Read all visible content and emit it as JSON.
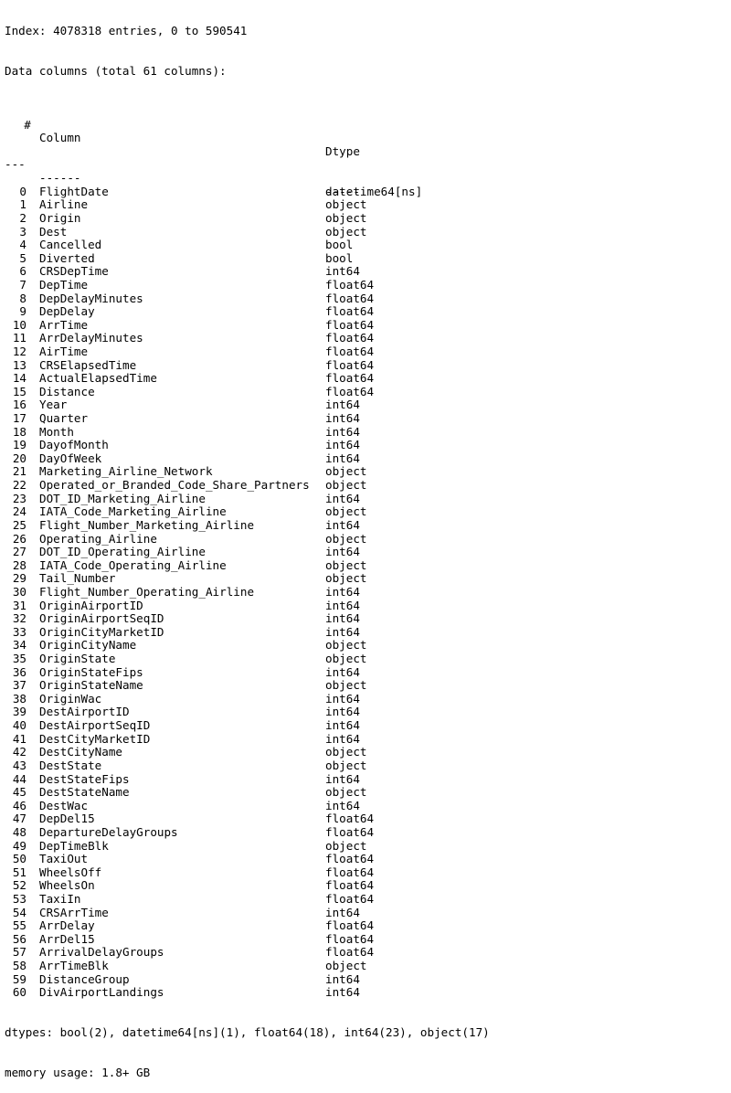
{
  "header": {
    "index_line": "Index: 4078318 entries, 0 to 590541",
    "columns_line": "Data columns (total 61 columns):"
  },
  "table": {
    "headers": {
      "num": "#",
      "column": "Column",
      "dtype": "Dtype"
    },
    "rule": {
      "num": "---",
      "column": "------",
      "dtype": "-----"
    },
    "rows": [
      {
        "i": "0",
        "name": "FlightDate",
        "dtype": "datetime64[ns]"
      },
      {
        "i": "1",
        "name": "Airline",
        "dtype": "object"
      },
      {
        "i": "2",
        "name": "Origin",
        "dtype": "object"
      },
      {
        "i": "3",
        "name": "Dest",
        "dtype": "object"
      },
      {
        "i": "4",
        "name": "Cancelled",
        "dtype": "bool"
      },
      {
        "i": "5",
        "name": "Diverted",
        "dtype": "bool"
      },
      {
        "i": "6",
        "name": "CRSDepTime",
        "dtype": "int64"
      },
      {
        "i": "7",
        "name": "DepTime",
        "dtype": "float64"
      },
      {
        "i": "8",
        "name": "DepDelayMinutes",
        "dtype": "float64"
      },
      {
        "i": "9",
        "name": "DepDelay",
        "dtype": "float64"
      },
      {
        "i": "10",
        "name": "ArrTime",
        "dtype": "float64"
      },
      {
        "i": "11",
        "name": "ArrDelayMinutes",
        "dtype": "float64"
      },
      {
        "i": "12",
        "name": "AirTime",
        "dtype": "float64"
      },
      {
        "i": "13",
        "name": "CRSElapsedTime",
        "dtype": "float64"
      },
      {
        "i": "14",
        "name": "ActualElapsedTime",
        "dtype": "float64"
      },
      {
        "i": "15",
        "name": "Distance",
        "dtype": "float64"
      },
      {
        "i": "16",
        "name": "Year",
        "dtype": "int64"
      },
      {
        "i": "17",
        "name": "Quarter",
        "dtype": "int64"
      },
      {
        "i": "18",
        "name": "Month",
        "dtype": "int64"
      },
      {
        "i": "19",
        "name": "DayofMonth",
        "dtype": "int64"
      },
      {
        "i": "20",
        "name": "DayOfWeek",
        "dtype": "int64"
      },
      {
        "i": "21",
        "name": "Marketing_Airline_Network",
        "dtype": "object"
      },
      {
        "i": "22",
        "name": "Operated_or_Branded_Code_Share_Partners",
        "dtype": "object"
      },
      {
        "i": "23",
        "name": "DOT_ID_Marketing_Airline",
        "dtype": "int64"
      },
      {
        "i": "24",
        "name": "IATA_Code_Marketing_Airline",
        "dtype": "object"
      },
      {
        "i": "25",
        "name": "Flight_Number_Marketing_Airline",
        "dtype": "int64"
      },
      {
        "i": "26",
        "name": "Operating_Airline",
        "dtype": "object"
      },
      {
        "i": "27",
        "name": "DOT_ID_Operating_Airline",
        "dtype": "int64"
      },
      {
        "i": "28",
        "name": "IATA_Code_Operating_Airline",
        "dtype": "object"
      },
      {
        "i": "29",
        "name": "Tail_Number",
        "dtype": "object"
      },
      {
        "i": "30",
        "name": "Flight_Number_Operating_Airline",
        "dtype": "int64"
      },
      {
        "i": "31",
        "name": "OriginAirportID",
        "dtype": "int64"
      },
      {
        "i": "32",
        "name": "OriginAirportSeqID",
        "dtype": "int64"
      },
      {
        "i": "33",
        "name": "OriginCityMarketID",
        "dtype": "int64"
      },
      {
        "i": "34",
        "name": "OriginCityName",
        "dtype": "object"
      },
      {
        "i": "35",
        "name": "OriginState",
        "dtype": "object"
      },
      {
        "i": "36",
        "name": "OriginStateFips",
        "dtype": "int64"
      },
      {
        "i": "37",
        "name": "OriginStateName",
        "dtype": "object"
      },
      {
        "i": "38",
        "name": "OriginWac",
        "dtype": "int64"
      },
      {
        "i": "39",
        "name": "DestAirportID",
        "dtype": "int64"
      },
      {
        "i": "40",
        "name": "DestAirportSeqID",
        "dtype": "int64"
      },
      {
        "i": "41",
        "name": "DestCityMarketID",
        "dtype": "int64"
      },
      {
        "i": "42",
        "name": "DestCityName",
        "dtype": "object"
      },
      {
        "i": "43",
        "name": "DestState",
        "dtype": "object"
      },
      {
        "i": "44",
        "name": "DestStateFips",
        "dtype": "int64"
      },
      {
        "i": "45",
        "name": "DestStateName",
        "dtype": "object"
      },
      {
        "i": "46",
        "name": "DestWac",
        "dtype": "int64"
      },
      {
        "i": "47",
        "name": "DepDel15",
        "dtype": "float64"
      },
      {
        "i": "48",
        "name": "DepartureDelayGroups",
        "dtype": "float64"
      },
      {
        "i": "49",
        "name": "DepTimeBlk",
        "dtype": "object"
      },
      {
        "i": "50",
        "name": "TaxiOut",
        "dtype": "float64"
      },
      {
        "i": "51",
        "name": "WheelsOff",
        "dtype": "float64"
      },
      {
        "i": "52",
        "name": "WheelsOn",
        "dtype": "float64"
      },
      {
        "i": "53",
        "name": "TaxiIn",
        "dtype": "float64"
      },
      {
        "i": "54",
        "name": "CRSArrTime",
        "dtype": "int64"
      },
      {
        "i": "55",
        "name": "ArrDelay",
        "dtype": "float64"
      },
      {
        "i": "56",
        "name": "ArrDel15",
        "dtype": "float64"
      },
      {
        "i": "57",
        "name": "ArrivalDelayGroups",
        "dtype": "float64"
      },
      {
        "i": "58",
        "name": "ArrTimeBlk",
        "dtype": "object"
      },
      {
        "i": "59",
        "name": "DistanceGroup",
        "dtype": "int64"
      },
      {
        "i": "60",
        "name": "DivAirportLandings",
        "dtype": "int64"
      }
    ]
  },
  "footer": {
    "dtypes_line": "dtypes: bool(2), datetime64[ns](1), float64(18), int64(23), object(17)",
    "memory_line": "memory usage: 1.8+ GB"
  }
}
